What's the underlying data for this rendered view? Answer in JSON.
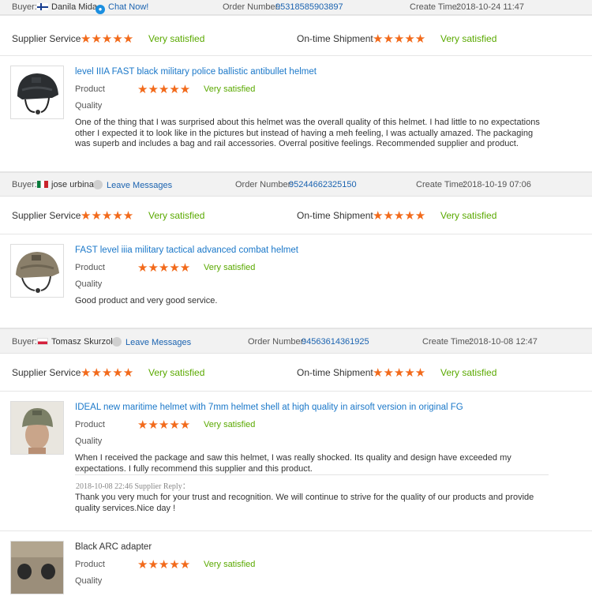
{
  "labels": {
    "buyer": "Buyer:",
    "order_number": "Order Number:",
    "create_time": "Create Time:",
    "supplier_service": "Supplier Service",
    "ontime_shipment": "On-time Shipment",
    "product": "Product",
    "quality": "Quality",
    "stars": "★★★★★",
    "very_satisfied": "Very satisfied"
  },
  "reviews": [
    {
      "buyer_name": "Danila Mida",
      "action": "Chat Now!",
      "order_number": "95318585903897",
      "create_time": "2018-10-24 11:47",
      "product_title": "level IIIA FAST black military police ballistic antibullet helmet",
      "comment": "One of the thing that I was surprised about this helmet was the overall quality of this helmet. I had little to no expectations other I expected it to look like in the pictures but instead of having a meh feeling, I was actually amazed. The packaging was superb and includes a bag and rail accessories. Overral positive feelings. Recommended supplier and product."
    },
    {
      "buyer_name": "jose urbina",
      "action": "Leave Messages",
      "order_number": "95244662325150",
      "create_time": "2018-10-19 07:06",
      "product_title": "FAST level iiia military tactical advanced combat helmet",
      "comment": "Good product and very good service."
    },
    {
      "buyer_name": "Tomasz Skurzok",
      "action": "Leave Messages",
      "order_number": "94563614361925",
      "create_time": "2018-10-08 12:47",
      "product_title": "IDEAL new maritime helmet with 7mm helmet shell at high quality in airsoft version in original FG",
      "comment": "When I received the package and saw this helmet, I was really shocked. Its quality and design have exceeded my expectations. I fully recommend this supplier and this product.",
      "reply_meta": "2018-10-08 22:46  Supplier Reply：",
      "reply_text": "Thank you very much for your trust and recognition. We will continue to strive for the quality of our products and provide quality services.Nice day !"
    },
    {
      "product_title": "Black ARC adapter"
    }
  ]
}
